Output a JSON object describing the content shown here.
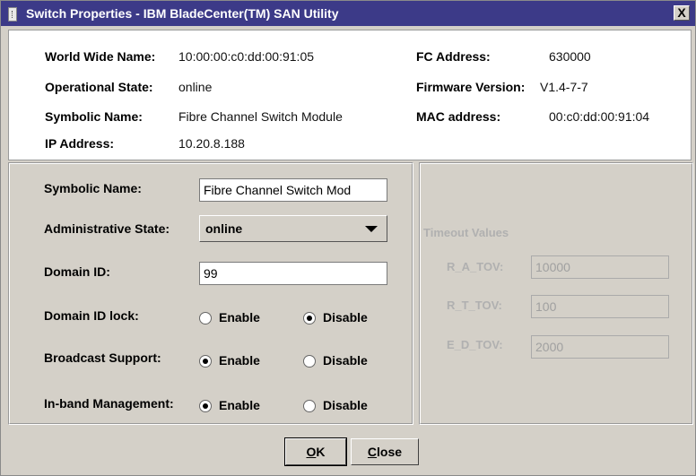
{
  "window": {
    "title": "Switch Properties - IBM BladeCenter(TM) SAN Utility",
    "close_label": "X"
  },
  "info": {
    "wwn_label": "World Wide Name:",
    "wwn_value": "10:00:00:c0:dd:00:91:05",
    "fc_label": "FC Address:",
    "fc_value": "630000",
    "opstate_label": "Operational State:",
    "opstate_value": "online",
    "firmware_label": "Firmware Version:",
    "firmware_value": "V1.4-7-7",
    "symname_label": "Symbolic Name:",
    "symname_value": "Fibre Channel Switch Module",
    "mac_label": "MAC address:",
    "mac_value": "00:c0:dd:00:91:04",
    "ip_label": "IP Address:",
    "ip_value": "10.20.8.188"
  },
  "form": {
    "symname_label": "Symbolic Name:",
    "symname_value": "Fibre Channel Switch Mod",
    "admin_label": "Administrative State:",
    "admin_value": "online",
    "domain_label": "Domain ID:",
    "domain_value": "99",
    "domainlock_label": "Domain ID lock:",
    "broadcast_label": "Broadcast Support:",
    "inband_label": "In-band Management:",
    "enable_label": "Enable",
    "disable_label": "Disable"
  },
  "timeouts": {
    "heading": "Timeout Values",
    "ra_label": "R_A_TOV:",
    "ra_value": "10000",
    "rt_label": "R_T_TOV:",
    "rt_value": "100",
    "ed_label": "E_D_TOV:",
    "ed_value": "2000"
  },
  "buttons": {
    "ok_mnemonic": "O",
    "ok_rest": "K",
    "close_mnemonic": "C",
    "close_rest": "lose"
  },
  "colors": {
    "titlebar": "#3c3a88",
    "dialog_bg": "#d4d0c8",
    "disabled_text": "#a0a0a0"
  }
}
